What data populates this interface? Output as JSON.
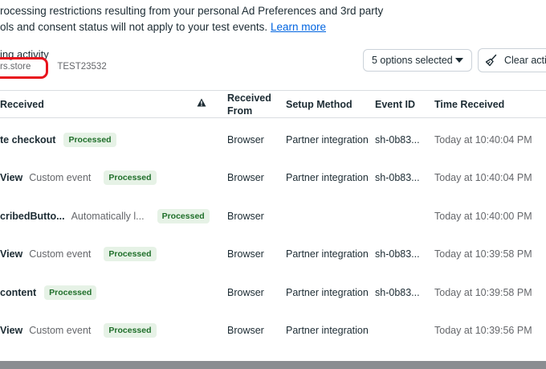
{
  "notice": {
    "line1": "rocessing restrictions resulting from your personal Ad Preferences and 3rd party",
    "line2": "ols and consent status will not apply to your test events.",
    "link": "Learn more"
  },
  "activity": {
    "title": "ing activity",
    "store": "rs.store",
    "separator": "|",
    "test_code": "TEST23532"
  },
  "toolbar": {
    "select_label": "5 options selected",
    "clear_label": "Clear activ"
  },
  "table": {
    "headers": {
      "received": "Received",
      "received_from": "Received From",
      "setup_method": "Setup Method",
      "event_id": "Event ID",
      "time_received": "Time Received"
    },
    "rows": [
      {
        "name": "te checkout",
        "type": "",
        "status": "Processed",
        "from": "Browser",
        "setup": "Partner integration",
        "event_id": "sh-0b83...",
        "time": "Today at 10:40:04 PM"
      },
      {
        "name": "View",
        "type": "Custom event",
        "status": "Processed",
        "from": "Browser",
        "setup": "Partner integration",
        "event_id": "sh-0b83...",
        "time": "Today at 10:40:04 PM"
      },
      {
        "name": "cribedButto...",
        "type": "Automatically l...",
        "status": "Processed",
        "from": "Browser",
        "setup": "",
        "event_id": "",
        "time": "Today at 10:40:00 PM"
      },
      {
        "name": "View",
        "type": "Custom event",
        "status": "Processed",
        "from": "Browser",
        "setup": "Partner integration",
        "event_id": "sh-0b83...",
        "time": "Today at 10:39:58 PM"
      },
      {
        "name": "content",
        "type": "",
        "status": "Processed",
        "from": "Browser",
        "setup": "Partner integration",
        "event_id": "sh-0b83...",
        "time": "Today at 10:39:58 PM"
      },
      {
        "name": "View",
        "type": "Custom event",
        "status": "Processed",
        "from": "Browser",
        "setup": "Partner integration",
        "event_id": "",
        "time": "Today at 10:39:56 PM"
      }
    ]
  },
  "icons": {
    "warning": "warning-icon",
    "broom": "broom-icon",
    "caret": "chevron-down-icon"
  },
  "colors": {
    "link": "#0064e0",
    "badge_bg": "#e6f2e6",
    "badge_text": "#1f6f2a",
    "highlight": "#e8131d"
  }
}
